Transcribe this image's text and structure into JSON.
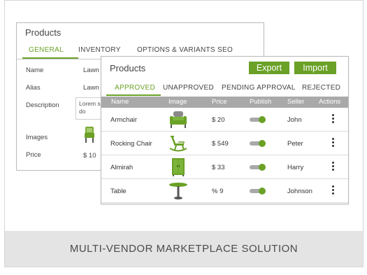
{
  "back_window": {
    "title": "Products",
    "tabs": [
      "GENERAL",
      "INVENTORY",
      "OPTIONS & VARIANTS",
      "SEO"
    ],
    "fields": {
      "name_label": "Name",
      "name_value": "Lawn",
      "alias_label": "Alias",
      "alias_value": "Lawn",
      "description_label": "Description",
      "description_value": "Lorem sed do",
      "images_label": "Images",
      "price_label": "Price",
      "price_value": "$ 10"
    }
  },
  "front_window": {
    "title": "Products",
    "export_label": "Export",
    "import_label": "Import",
    "tabs": [
      "APPROVED",
      "UNAPPROVED",
      "PENDING APPROVAL",
      "REJECTED"
    ],
    "columns": [
      "Name",
      "Image",
      "Price",
      "Publish",
      "Seller",
      "Actions"
    ],
    "rows": [
      {
        "name": "Armchair",
        "image_icon": "armchair-icon",
        "price": "$ 20",
        "seller": "John",
        "publish": true
      },
      {
        "name": "Rocking Chair",
        "image_icon": "rocking-chair-icon",
        "price": "$ 549",
        "seller": "Peter",
        "publish": true
      },
      {
        "name": "Almirah",
        "image_icon": "almirah-icon",
        "price": "$ 33",
        "seller": "Harry",
        "publish": true
      },
      {
        "name": "Table",
        "image_icon": "table-icon",
        "price": "% 9",
        "seller": "Johnson",
        "publish": true
      }
    ]
  },
  "footer": {
    "text": "MULTI-VENDOR MARKETPLACE SOLUTION"
  },
  "colors": {
    "accent": "#6aa126",
    "header_gray": "#a9a9a9",
    "footer_bg": "#e4e4e4"
  }
}
